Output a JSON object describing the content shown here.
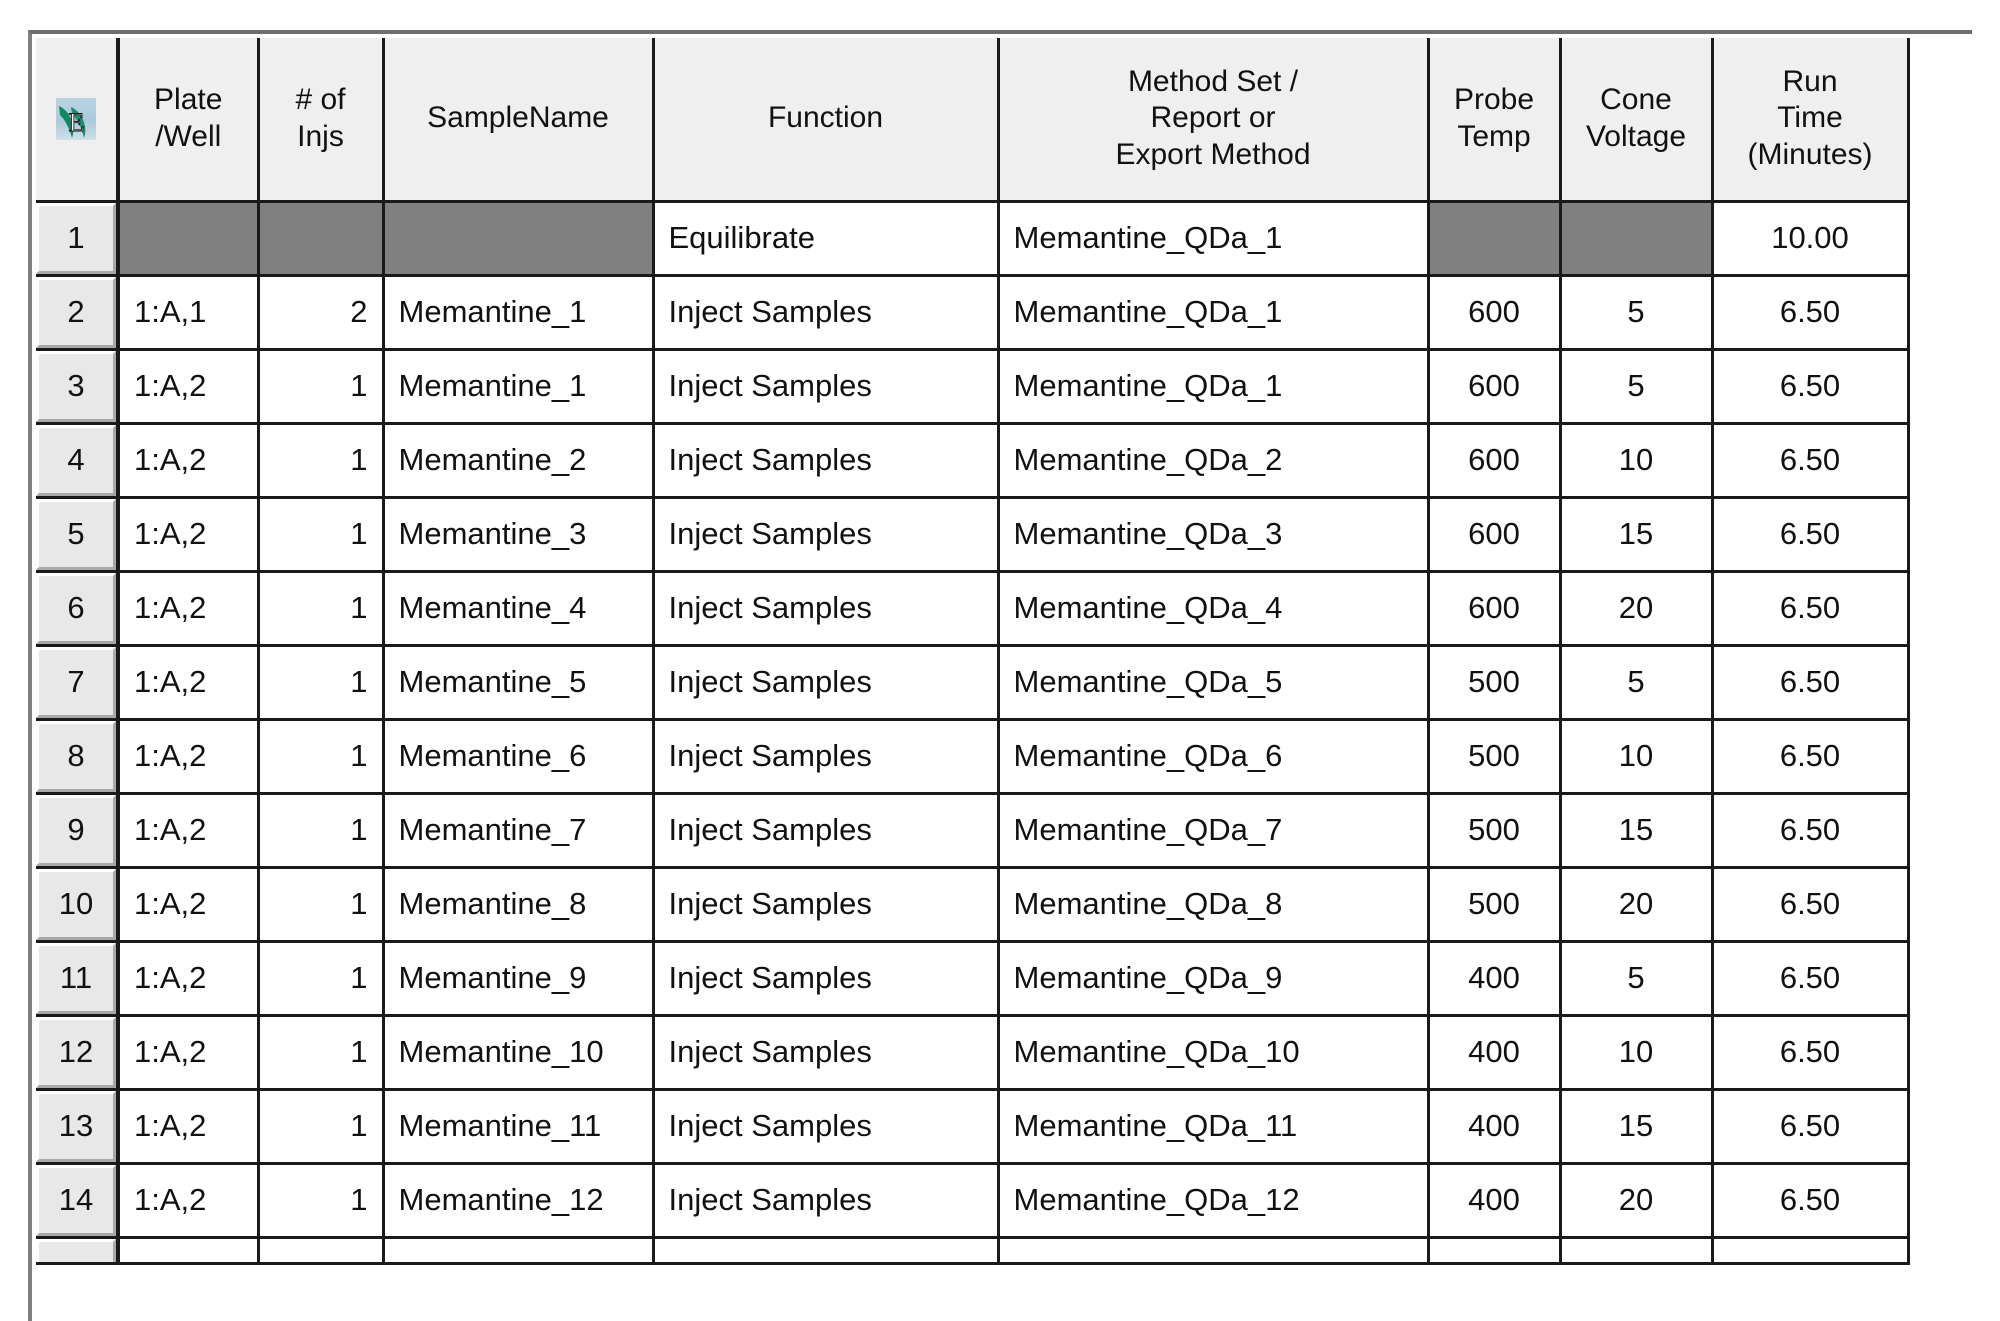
{
  "grid": {
    "icon": "waters-empower-icon",
    "columns": [
      {
        "key": "rownum",
        "label": ""
      },
      {
        "key": "plate",
        "label": "Plate\n/Well"
      },
      {
        "key": "injs",
        "label": "# of\nInjs"
      },
      {
        "key": "sample",
        "label": "SampleName"
      },
      {
        "key": "function",
        "label": "Function"
      },
      {
        "key": "method",
        "label": "Method Set /\nReport or\nExport Method"
      },
      {
        "key": "probe",
        "label": "Probe\nTemp"
      },
      {
        "key": "cone",
        "label": "Cone\nVoltage"
      },
      {
        "key": "runtime",
        "label": "Run\nTime\n(Minutes)"
      }
    ],
    "header_lines": {
      "plate": [
        "Plate",
        "/Well"
      ],
      "injs": [
        "# of",
        "Injs"
      ],
      "sample": [
        "SampleName"
      ],
      "function": [
        "Function"
      ],
      "method": [
        "Method Set /",
        "Report or",
        "Export Method"
      ],
      "probe": [
        "Probe",
        "Temp"
      ],
      "cone": [
        "Cone",
        "Voltage"
      ],
      "runtime": [
        "Run",
        "Time",
        "(Minutes)"
      ]
    },
    "rows": [
      {
        "rownum": "1",
        "plate": "",
        "injs": "",
        "sample": "",
        "function": "Equilibrate",
        "method": "Memantine_QDa_1",
        "probe": "",
        "cone": "",
        "runtime": "10.00",
        "disabled": [
          "plate",
          "injs",
          "sample",
          "probe",
          "cone"
        ]
      },
      {
        "rownum": "2",
        "plate": "1:A,1",
        "injs": "2",
        "sample": "Memantine_1",
        "function": "Inject Samples",
        "method": "Memantine_QDa_1",
        "probe": "600",
        "cone": "5",
        "runtime": "6.50",
        "disabled": []
      },
      {
        "rownum": "3",
        "plate": "1:A,2",
        "injs": "1",
        "sample": "Memantine_1",
        "function": "Inject Samples",
        "method": "Memantine_QDa_1",
        "probe": "600",
        "cone": "5",
        "runtime": "6.50",
        "disabled": []
      },
      {
        "rownum": "4",
        "plate": "1:A,2",
        "injs": "1",
        "sample": "Memantine_2",
        "function": "Inject Samples",
        "method": "Memantine_QDa_2",
        "probe": "600",
        "cone": "10",
        "runtime": "6.50",
        "disabled": []
      },
      {
        "rownum": "5",
        "plate": "1:A,2",
        "injs": "1",
        "sample": "Memantine_3",
        "function": "Inject Samples",
        "method": "Memantine_QDa_3",
        "probe": "600",
        "cone": "15",
        "runtime": "6.50",
        "disabled": []
      },
      {
        "rownum": "6",
        "plate": "1:A,2",
        "injs": "1",
        "sample": "Memantine_4",
        "function": "Inject Samples",
        "method": "Memantine_QDa_4",
        "probe": "600",
        "cone": "20",
        "runtime": "6.50",
        "disabled": []
      },
      {
        "rownum": "7",
        "plate": "1:A,2",
        "injs": "1",
        "sample": "Memantine_5",
        "function": "Inject Samples",
        "method": "Memantine_QDa_5",
        "probe": "500",
        "cone": "5",
        "runtime": "6.50",
        "disabled": []
      },
      {
        "rownum": "8",
        "plate": "1:A,2",
        "injs": "1",
        "sample": "Memantine_6",
        "function": "Inject Samples",
        "method": "Memantine_QDa_6",
        "probe": "500",
        "cone": "10",
        "runtime": "6.50",
        "disabled": []
      },
      {
        "rownum": "9",
        "plate": "1:A,2",
        "injs": "1",
        "sample": "Memantine_7",
        "function": "Inject Samples",
        "method": "Memantine_QDa_7",
        "probe": "500",
        "cone": "15",
        "runtime": "6.50",
        "disabled": []
      },
      {
        "rownum": "10",
        "plate": "1:A,2",
        "injs": "1",
        "sample": "Memantine_8",
        "function": "Inject Samples",
        "method": "Memantine_QDa_8",
        "probe": "500",
        "cone": "20",
        "runtime": "6.50",
        "disabled": []
      },
      {
        "rownum": "11",
        "plate": "1:A,2",
        "injs": "1",
        "sample": "Memantine_9",
        "function": "Inject Samples",
        "method": "Memantine_QDa_9",
        "probe": "400",
        "cone": "5",
        "runtime": "6.50",
        "disabled": []
      },
      {
        "rownum": "12",
        "plate": "1:A,2",
        "injs": "1",
        "sample": "Memantine_10",
        "function": "Inject Samples",
        "method": "Memantine_QDa_10",
        "probe": "400",
        "cone": "10",
        "runtime": "6.50",
        "disabled": []
      },
      {
        "rownum": "13",
        "plate": "1:A,2",
        "injs": "1",
        "sample": "Memantine_11",
        "function": "Inject Samples",
        "method": "Memantine_QDa_11",
        "probe": "400",
        "cone": "15",
        "runtime": "6.50",
        "disabled": []
      },
      {
        "rownum": "14",
        "plate": "1:A,2",
        "injs": "1",
        "sample": "Memantine_12",
        "function": "Inject Samples",
        "method": "Memantine_QDa_12",
        "probe": "400",
        "cone": "20",
        "runtime": "6.50",
        "disabled": []
      },
      {
        "rownum": "",
        "plate": "",
        "injs": "",
        "sample": "",
        "function": "",
        "method": "",
        "probe": "",
        "cone": "",
        "runtime": "",
        "disabled": [],
        "partial": true
      }
    ],
    "colors": {
      "header_background": "#efefef",
      "rownum_background": "#e8e8e8",
      "disabled_cell": "#808080",
      "grid_line": "#1a1a1a",
      "cell_background": "#ffffff",
      "text": "#111111",
      "icon_accent": "#0e8a63",
      "icon_background": "#b4d2e0"
    }
  }
}
